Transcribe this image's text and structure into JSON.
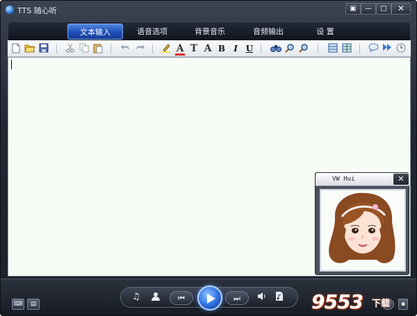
{
  "window": {
    "title": "TTS 随心听"
  },
  "titlebar": {
    "menu_icon": "dropdown-box-icon",
    "minimize_icon": "minimize-icon",
    "maximize_icon": "maximize-icon",
    "close_icon": "close-icon",
    "minimize_glyph": "—",
    "maximize_glyph": "□",
    "close_glyph": "✕",
    "menu_glyph": "▣"
  },
  "tabs": [
    {
      "label": "文本输入",
      "active": true
    },
    {
      "label": "语音选项",
      "active": false
    },
    {
      "label": "背景音乐",
      "active": false
    },
    {
      "label": "音频输出",
      "active": false
    },
    {
      "label": "设 置",
      "active": false
    }
  ],
  "toolbar": {
    "icons": [
      "new-document-icon",
      "open-folder-icon",
      "save-icon",
      "cut-icon",
      "copy-icon",
      "paste-icon",
      "undo-icon",
      "redo-icon",
      "highlight-pen-icon",
      "font-color-icon",
      "font-icon",
      "font-size-icon",
      "bold-icon",
      "italic-icon",
      "underline-icon",
      "find-icon",
      "find-next-icon",
      "replace-icon",
      "table-icon",
      "grid-icon",
      "speech-bubble-icon",
      "fast-forward-icon",
      "clock-icon"
    ],
    "font_color_letter": "A",
    "font_letter": "T",
    "font_size_letter": "A",
    "bold_letter": "B",
    "italic_letter": "I",
    "underline_letter": "U"
  },
  "editor": {
    "text": ""
  },
  "voice_panel": {
    "name": "VW Hui",
    "close_glyph": "✕"
  },
  "player": {
    "music_icon": "music-note-icon",
    "voice_icon": "person-icon",
    "prev_glyph": "⏮",
    "next_glyph": "⏭",
    "volume_icon": "speaker-icon",
    "file_icon": "audio-file-icon"
  },
  "bottom": {
    "left_icons": [
      "keyboard-icon",
      "window-icon"
    ],
    "right_icons": [
      "power-icon",
      "pin-icon"
    ]
  },
  "watermark": {
    "text": "9553",
    "suffix": "下载"
  },
  "colors": {
    "tab_active": "#2a5fcc",
    "editor_bg": "#f7fcf5",
    "chrome_dark": "#1c212a",
    "font_color_underline": "#e02020"
  }
}
